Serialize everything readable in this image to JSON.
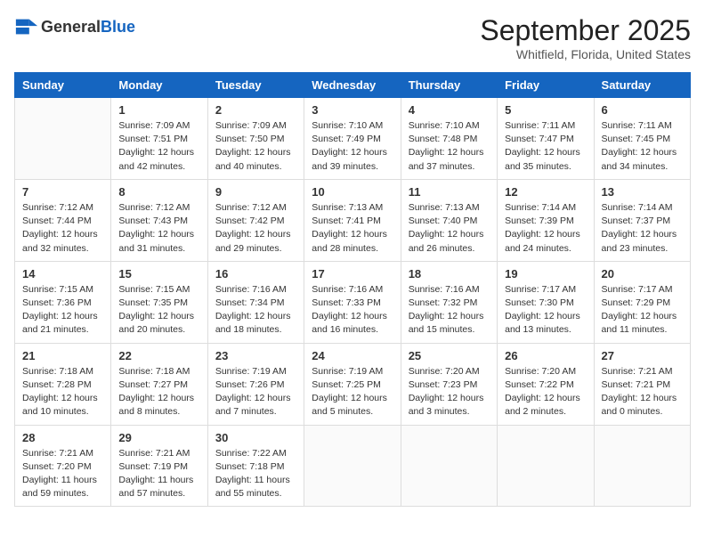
{
  "header": {
    "logo_general": "General",
    "logo_blue": "Blue",
    "month_title": "September 2025",
    "location": "Whitfield, Florida, United States"
  },
  "calendar": {
    "days_of_week": [
      "Sunday",
      "Monday",
      "Tuesday",
      "Wednesday",
      "Thursday",
      "Friday",
      "Saturday"
    ],
    "weeks": [
      [
        {
          "num": "",
          "info": ""
        },
        {
          "num": "1",
          "info": "Sunrise: 7:09 AM\nSunset: 7:51 PM\nDaylight: 12 hours\nand 42 minutes."
        },
        {
          "num": "2",
          "info": "Sunrise: 7:09 AM\nSunset: 7:50 PM\nDaylight: 12 hours\nand 40 minutes."
        },
        {
          "num": "3",
          "info": "Sunrise: 7:10 AM\nSunset: 7:49 PM\nDaylight: 12 hours\nand 39 minutes."
        },
        {
          "num": "4",
          "info": "Sunrise: 7:10 AM\nSunset: 7:48 PM\nDaylight: 12 hours\nand 37 minutes."
        },
        {
          "num": "5",
          "info": "Sunrise: 7:11 AM\nSunset: 7:47 PM\nDaylight: 12 hours\nand 35 minutes."
        },
        {
          "num": "6",
          "info": "Sunrise: 7:11 AM\nSunset: 7:45 PM\nDaylight: 12 hours\nand 34 minutes."
        }
      ],
      [
        {
          "num": "7",
          "info": "Sunrise: 7:12 AM\nSunset: 7:44 PM\nDaylight: 12 hours\nand 32 minutes."
        },
        {
          "num": "8",
          "info": "Sunrise: 7:12 AM\nSunset: 7:43 PM\nDaylight: 12 hours\nand 31 minutes."
        },
        {
          "num": "9",
          "info": "Sunrise: 7:12 AM\nSunset: 7:42 PM\nDaylight: 12 hours\nand 29 minutes."
        },
        {
          "num": "10",
          "info": "Sunrise: 7:13 AM\nSunset: 7:41 PM\nDaylight: 12 hours\nand 28 minutes."
        },
        {
          "num": "11",
          "info": "Sunrise: 7:13 AM\nSunset: 7:40 PM\nDaylight: 12 hours\nand 26 minutes."
        },
        {
          "num": "12",
          "info": "Sunrise: 7:14 AM\nSunset: 7:39 PM\nDaylight: 12 hours\nand 24 minutes."
        },
        {
          "num": "13",
          "info": "Sunrise: 7:14 AM\nSunset: 7:37 PM\nDaylight: 12 hours\nand 23 minutes."
        }
      ],
      [
        {
          "num": "14",
          "info": "Sunrise: 7:15 AM\nSunset: 7:36 PM\nDaylight: 12 hours\nand 21 minutes."
        },
        {
          "num": "15",
          "info": "Sunrise: 7:15 AM\nSunset: 7:35 PM\nDaylight: 12 hours\nand 20 minutes."
        },
        {
          "num": "16",
          "info": "Sunrise: 7:16 AM\nSunset: 7:34 PM\nDaylight: 12 hours\nand 18 minutes."
        },
        {
          "num": "17",
          "info": "Sunrise: 7:16 AM\nSunset: 7:33 PM\nDaylight: 12 hours\nand 16 minutes."
        },
        {
          "num": "18",
          "info": "Sunrise: 7:16 AM\nSunset: 7:32 PM\nDaylight: 12 hours\nand 15 minutes."
        },
        {
          "num": "19",
          "info": "Sunrise: 7:17 AM\nSunset: 7:30 PM\nDaylight: 12 hours\nand 13 minutes."
        },
        {
          "num": "20",
          "info": "Sunrise: 7:17 AM\nSunset: 7:29 PM\nDaylight: 12 hours\nand 11 minutes."
        }
      ],
      [
        {
          "num": "21",
          "info": "Sunrise: 7:18 AM\nSunset: 7:28 PM\nDaylight: 12 hours\nand 10 minutes."
        },
        {
          "num": "22",
          "info": "Sunrise: 7:18 AM\nSunset: 7:27 PM\nDaylight: 12 hours\nand 8 minutes."
        },
        {
          "num": "23",
          "info": "Sunrise: 7:19 AM\nSunset: 7:26 PM\nDaylight: 12 hours\nand 7 minutes."
        },
        {
          "num": "24",
          "info": "Sunrise: 7:19 AM\nSunset: 7:25 PM\nDaylight: 12 hours\nand 5 minutes."
        },
        {
          "num": "25",
          "info": "Sunrise: 7:20 AM\nSunset: 7:23 PM\nDaylight: 12 hours\nand 3 minutes."
        },
        {
          "num": "26",
          "info": "Sunrise: 7:20 AM\nSunset: 7:22 PM\nDaylight: 12 hours\nand 2 minutes."
        },
        {
          "num": "27",
          "info": "Sunrise: 7:21 AM\nSunset: 7:21 PM\nDaylight: 12 hours\nand 0 minutes."
        }
      ],
      [
        {
          "num": "28",
          "info": "Sunrise: 7:21 AM\nSunset: 7:20 PM\nDaylight: 11 hours\nand 59 minutes."
        },
        {
          "num": "29",
          "info": "Sunrise: 7:21 AM\nSunset: 7:19 PM\nDaylight: 11 hours\nand 57 minutes."
        },
        {
          "num": "30",
          "info": "Sunrise: 7:22 AM\nSunset: 7:18 PM\nDaylight: 11 hours\nand 55 minutes."
        },
        {
          "num": "",
          "info": ""
        },
        {
          "num": "",
          "info": ""
        },
        {
          "num": "",
          "info": ""
        },
        {
          "num": "",
          "info": ""
        }
      ]
    ]
  }
}
